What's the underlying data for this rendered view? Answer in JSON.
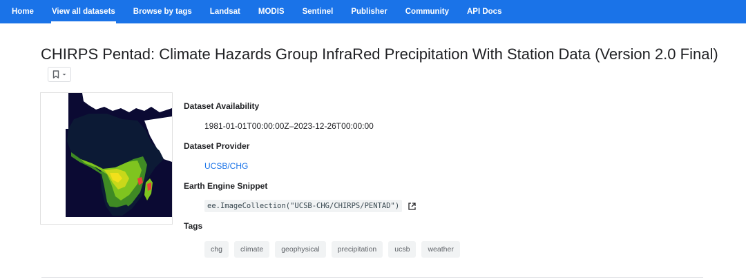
{
  "nav": {
    "items": [
      {
        "label": "Home"
      },
      {
        "label": "View all datasets"
      },
      {
        "label": "Browse by tags"
      },
      {
        "label": "Landsat"
      },
      {
        "label": "MODIS"
      },
      {
        "label": "Sentinel"
      },
      {
        "label": "Publisher"
      },
      {
        "label": "Community"
      },
      {
        "label": "API Docs"
      }
    ],
    "active": "View all datasets"
  },
  "page": {
    "title": "CHIRPS Pentad: Climate Hazards Group InfraRed Precipitation With Station Data (Version 2.0 Final)",
    "bookmark_icon": "bookmark-icon"
  },
  "metadata": {
    "availability_label": "Dataset Availability",
    "availability_value": "1981-01-01T00:00:00Z–2023-12-26T00:00:00",
    "provider_label": "Dataset Provider",
    "provider_value": "UCSB/CHG",
    "snippet_label": "Earth Engine Snippet",
    "snippet_value": "ee.ImageCollection(\"UCSB-CHG/CHIRPS/PENTAD\")",
    "tags_label": "Tags",
    "tags": [
      "chg",
      "climate",
      "geophysical",
      "precipitation",
      "ucsb",
      "weather"
    ]
  },
  "colors": {
    "nav_bg": "#1a73e8",
    "link": "#1a73e8",
    "map_ocean": "#0b0a33",
    "map_land_dry": "#0c1430",
    "map_wet": "#7fc41f",
    "map_very_wet": "#f2e01b",
    "map_extreme": "#e8413a"
  }
}
